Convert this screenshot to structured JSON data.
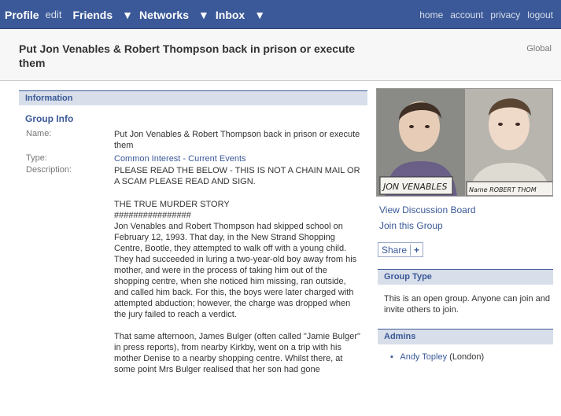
{
  "nav": {
    "profile": "Profile",
    "edit": "edit",
    "friends": "Friends",
    "networks": "Networks",
    "inbox": "Inbox",
    "arrow": "▼",
    "home": "home",
    "account": "account",
    "privacy": "privacy",
    "logout": "logout"
  },
  "header": {
    "title": "Put Jon Venables & Robert Thompson back in prison or execute them",
    "scope": "Global"
  },
  "info": {
    "section_title": "Information",
    "group_info": "Group Info",
    "name_label": "Name:",
    "name_value": "Put Jon Venables & Robert Thompson back in prison or execute them",
    "type_label": "Type:",
    "type_value": "Common Interest - Current Events",
    "desc_label": "Description:",
    "desc_intro": "PLEASE READ THE BELOW - THIS IS NOT A CHAIN MAIL OR A SCAM PLEASE READ AND SIGN.",
    "story_heading": "THE TRUE MURDER STORY",
    "story_rule": "################",
    "story_p1": "Jon Venables and Robert Thompson had skipped school on February 12, 1993. That day, in the New Strand Shopping Centre, Bootle, they attempted to walk off with a young child. They had succeeded in luring a two-year-old boy away from his mother, and were in the process of taking him out of the shopping centre, when she noticed him missing, ran outside, and called him back. For this, the boys were later charged with attempted abduction; however, the charge was dropped when the jury failed to reach a verdict.",
    "story_p2": "That same afternoon, James Bulger (often called \"Jamie Bulger\" in press reports), from nearby Kirkby, went on a trip with his mother Denise to a nearby shopping centre. Whilst there, at some point Mrs Bulger realised that her son had gone"
  },
  "photo": {
    "caption_left": "JON VENABLES",
    "caption_right": "Name ROBERT THOM"
  },
  "sidebar": {
    "view_board": "View Discussion Board",
    "join": "Join this Group",
    "share": "Share",
    "share_plus": "+",
    "group_type_title": "Group Type",
    "group_type_text": "This is an open group. Anyone can join and invite others to join.",
    "admins_title": "Admins",
    "admin_bullet": "▪",
    "admin_name": "Andy Topley",
    "admin_location": "(London)"
  },
  "colors": {
    "brand": "#3b5998",
    "header_bg": "#f7f7f7",
    "box_head": "#d8dfea"
  }
}
